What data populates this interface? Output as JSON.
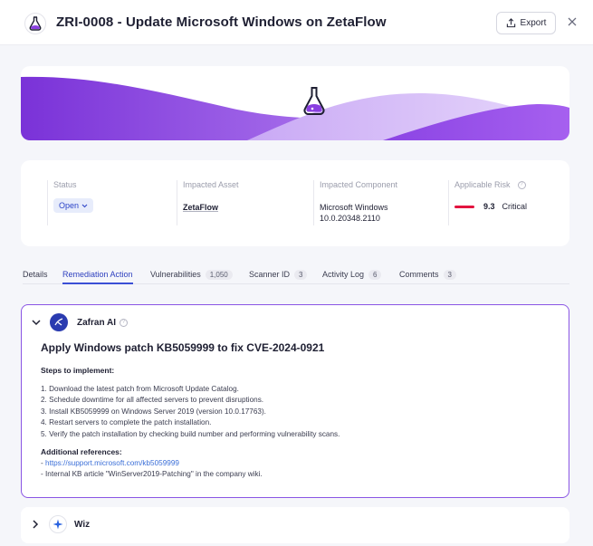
{
  "header": {
    "title": "ZRI-0008 - Update Microsoft Windows on ZetaFlow",
    "export_label": "Export"
  },
  "info": {
    "status": {
      "label": "Status",
      "value": "Open"
    },
    "asset": {
      "label": "Impacted Asset",
      "value": "ZetaFlow"
    },
    "component": {
      "label": "Impacted Component",
      "name": "Microsoft Windows",
      "version": "10.0.20348.2110"
    },
    "risk": {
      "label": "Applicable Risk",
      "score": "9.3",
      "severity": "Critical",
      "color": "#e3143f"
    }
  },
  "tabs": [
    {
      "label": "Details"
    },
    {
      "label": "Remediation Action",
      "active": true
    },
    {
      "label": "Vulnerabilities",
      "count": "1,050"
    },
    {
      "label": "Scanner ID",
      "count": "3"
    },
    {
      "label": "Activity Log",
      "count": "6"
    },
    {
      "label": "Comments",
      "count": "3"
    }
  ],
  "ai": {
    "name": "Zafran AI",
    "title": "Apply Windows patch KB5059999 to fix CVE-2024-0921",
    "steps_heading": "Steps to implement:",
    "steps": [
      "1. Download the latest patch from Microsoft Update Catalog.",
      "2. Schedule downtime for all affected servers to prevent disruptions.",
      "3. Install KB5059999 on Windows Server 2019 (version 10.0.17763).",
      "4. Restart servers to complete the patch installation.",
      "5. Verify the patch installation by checking build number and performing vulnerability scans."
    ],
    "refs_heading": "Additional references:",
    "ref_link": "https://support.microsoft.com/kb5059999",
    "ref_prefix": "- ",
    "ref_internal": "- Internal KB article \"WinServer2019-Patching\" in the company wiki."
  },
  "wiz": {
    "name": "Wiz"
  },
  "colors": {
    "accent": "#3b4fd6",
    "banner_purple": "#8a3fe0",
    "ai_border": "#8a55e4"
  }
}
